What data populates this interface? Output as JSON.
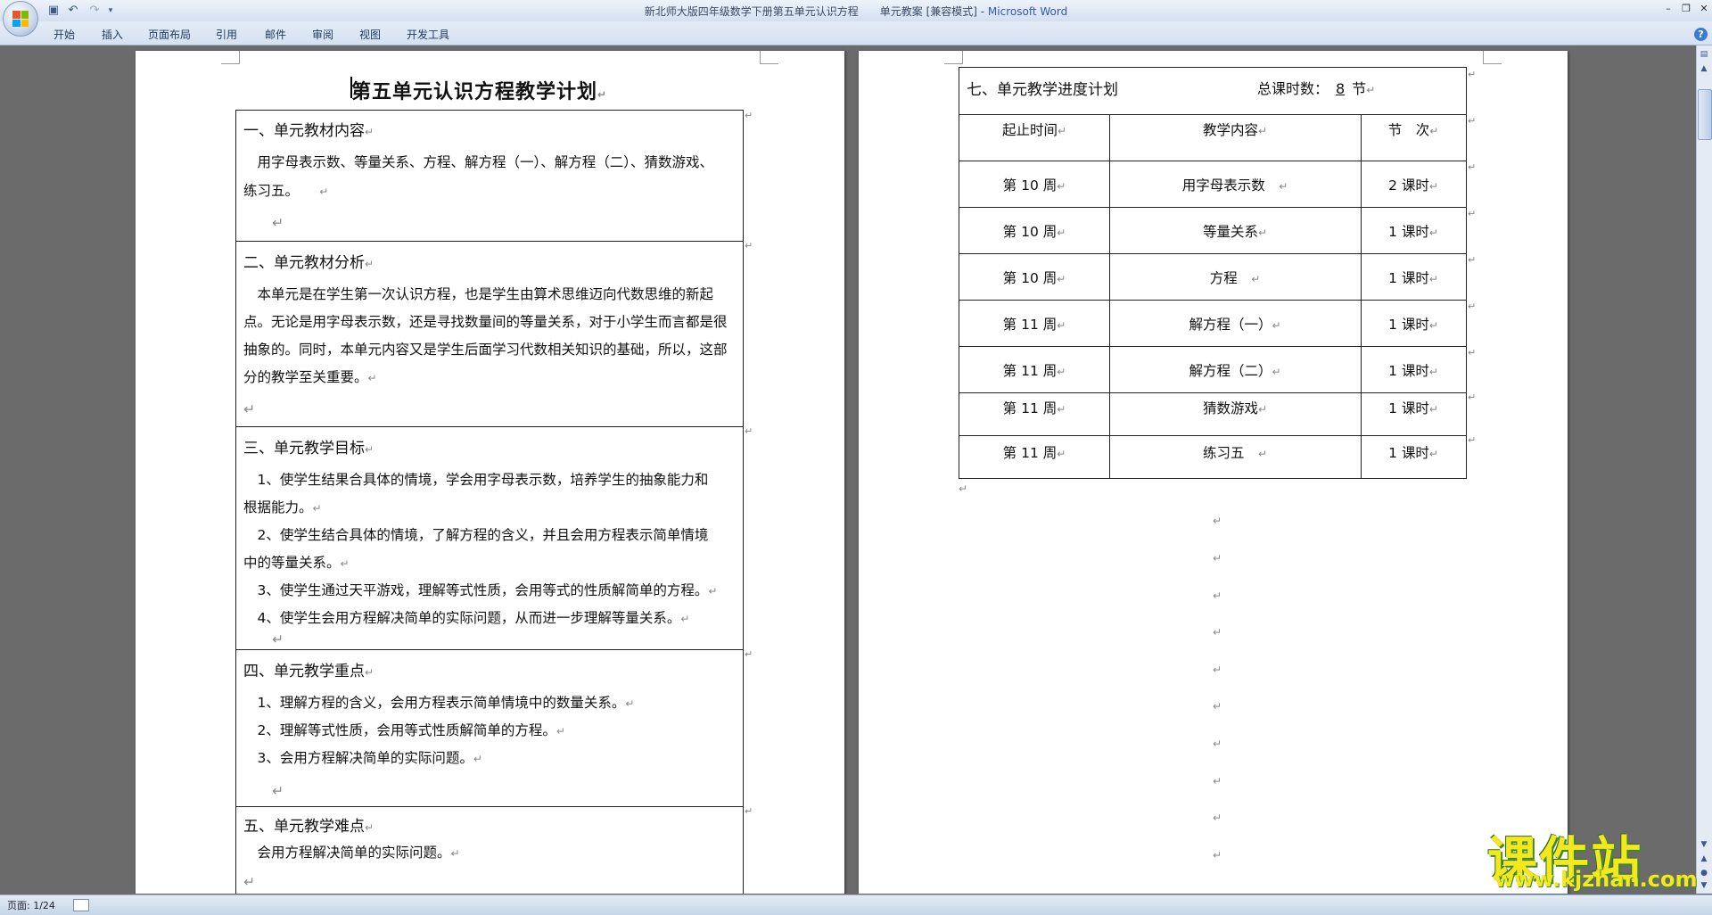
{
  "window": {
    "title_doc": "新北师大版四年级数学下册第五单元认识方程　　单元教案 [兼容模式] - ",
    "title_app": "Microsoft Word"
  },
  "ribbon": {
    "tabs": [
      "开始",
      "插入",
      "页面布局",
      "引用",
      "邮件",
      "审阅",
      "视图",
      "开发工具"
    ]
  },
  "page1": {
    "title": "第五单元认识方程教学计划",
    "sections": [
      {
        "heading": "一、单元教材内容",
        "lines": [
          "　用字母表示数、等量关系、方程、解方程（一）、解方程（二）、猜数游戏、",
          "练习五。　　"
        ]
      },
      {
        "heading": "二、单元教材分析",
        "lines": [
          "　本单元是在学生第一次认识方程，也是学生由算术思维迈向代数思维的新起",
          "点。无论是用字母表示数，还是寻找数量间的等量关系，对于小学生而言都是很",
          "抽象的。同时，本单元内容又是学生后面学习代数相关知识的基础，所以，这部",
          "分的教学至关重要。"
        ]
      },
      {
        "heading": "三、单元教学目标",
        "lines": [
          "　1、使学生结果合具体的情境，学会用字母表示数，培养学生的抽象能力和",
          "根据能力。",
          "　2、使学生结合具体的情境，了解方程的含义，并且会用方程表示简单情境",
          "中的等量关系。",
          "　3、使学生通过天平游戏，理解等式性质，会用等式的性质解简单的方程。",
          "　4、使学生会用方程解决简单的实际问题，从而进一步理解等量关系。"
        ]
      },
      {
        "heading": "四、单元教学重点",
        "lines": [
          "　1、理解方程的含义，会用方程表示简单情境中的数量关系。",
          "　2、理解等式性质，会用等式性质解简单的方程。",
          "　3、会用方程解决简单的实际问题。"
        ]
      },
      {
        "heading": "五、单元教学难点",
        "lines": [
          "　会用方程解决简单的实际问题。"
        ]
      }
    ]
  },
  "page2": {
    "schedule_title": "七、单元教学进度计划",
    "total_label": "总课时数：",
    "total_value": "8",
    "total_unit": "节",
    "headers": [
      "起止时间",
      "教学内容",
      "节　次"
    ],
    "rows": [
      [
        "第 10 周",
        "用字母表示数",
        "2 课时"
      ],
      [
        "第 10 周",
        "等量关系",
        "1 课时"
      ],
      [
        "第 10 周",
        "方程",
        "1 课时"
      ],
      [
        "第 11 周",
        "解方程（一）",
        "1 课时"
      ],
      [
        "第 11 周",
        "解方程（二）",
        "1 课时"
      ],
      [
        "第 11 周",
        "猜数游戏",
        "1 课时"
      ],
      [
        "第 11 周",
        "练习五",
        "1 课时"
      ]
    ]
  },
  "status": {
    "page": "页面: 1/24"
  },
  "watermark": {
    "main": "课件站",
    "url": "www.kjzhan.com"
  },
  "marks": {
    "para": "↵"
  }
}
